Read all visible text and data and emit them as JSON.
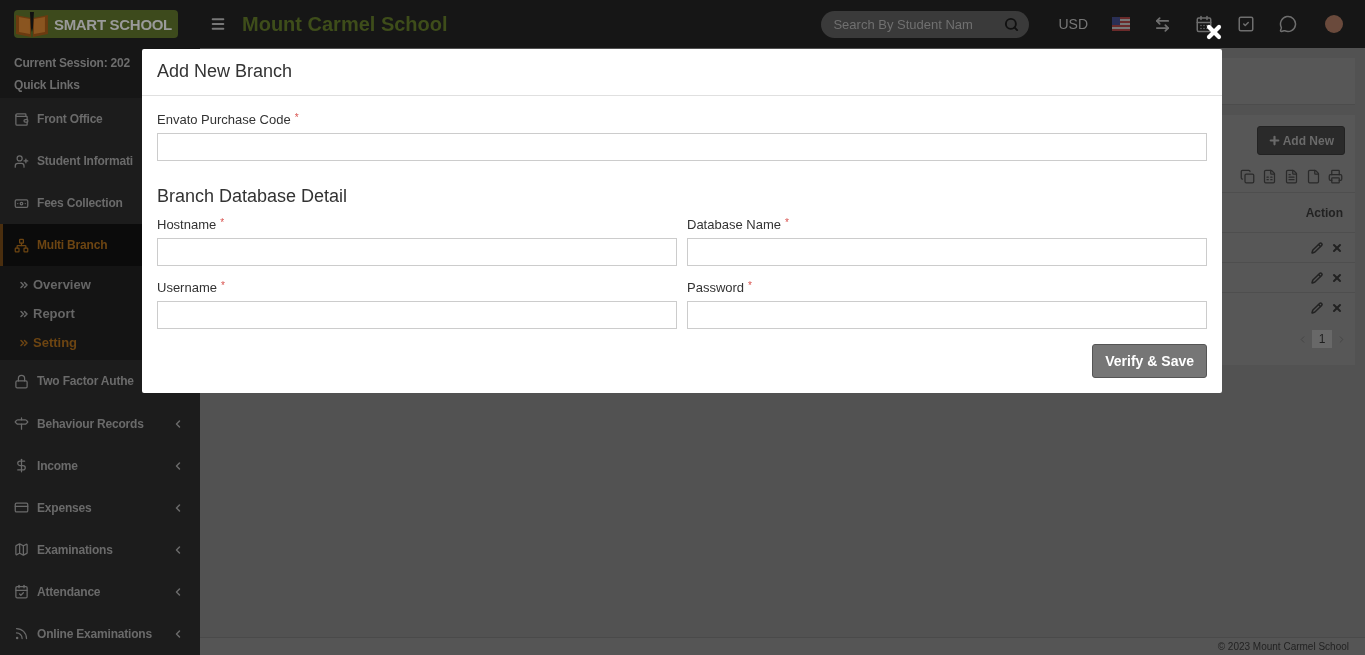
{
  "header": {
    "logo_text": "SMART SCHOOL",
    "school_name": "Mount Carmel School",
    "search": {
      "placeholder": "Search By Student Nam"
    },
    "currency": "USD"
  },
  "sidebar": {
    "session": "Current Session: 202",
    "quick_links": "Quick Links",
    "items": [
      {
        "label": "Front Office",
        "selected": false
      },
      {
        "label": "Student Informati",
        "selected": false
      },
      {
        "label": "Fees Collection",
        "selected": false
      },
      {
        "label": "Multi Branch",
        "selected": true,
        "children": [
          {
            "label": "Overview",
            "selected": false
          },
          {
            "label": "Report",
            "selected": false
          },
          {
            "label": "Setting",
            "selected": true
          }
        ]
      },
      {
        "label": "Two Factor Authe",
        "selected": false
      },
      {
        "label": "Behaviour Records",
        "selected": false,
        "chevron": true
      },
      {
        "label": "Income",
        "selected": false,
        "chevron": true
      },
      {
        "label": "Expenses",
        "selected": false,
        "chevron": true
      },
      {
        "label": "Examinations",
        "selected": false,
        "chevron": true
      },
      {
        "label": "Attendance",
        "selected": false,
        "chevron": true
      },
      {
        "label": "Online Examinations",
        "selected": false,
        "chevron": true
      }
    ]
  },
  "content": {
    "add_button": "Add New",
    "table": {
      "columns": [
        "Action"
      ]
    },
    "pagination": {
      "pages": [
        {
          "label": "1",
          "selected": true
        }
      ]
    }
  },
  "footer": "© 2023 Mount Carmel School",
  "modal": {
    "title": "Add New Branch",
    "purchase_code": {
      "label": "Envato Purchase Code",
      "required_mark": "*"
    },
    "section_title": "Branch Database Detail",
    "fields": [
      {
        "label": "Hostname",
        "required_mark": "*"
      },
      {
        "label": "Database Name",
        "required_mark": "*"
      },
      {
        "label": "Username",
        "required_mark": "*"
      },
      {
        "label": "Password",
        "required_mark": "*"
      }
    ],
    "submit": "Verify & Save"
  }
}
